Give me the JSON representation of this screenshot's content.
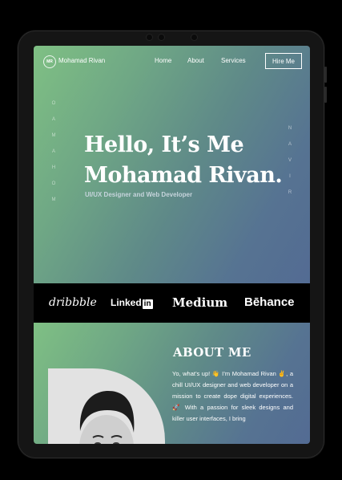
{
  "nav": {
    "logo_text": "MR",
    "brand": "Mohamad Rivan",
    "links": [
      "Home",
      "About",
      "Services"
    ],
    "cta": "Hire Me"
  },
  "hero": {
    "title_line1": "Hello, It’s Me",
    "title_line2": "Mohamad Rivan.",
    "subtitle": "UI/UX Designer and Web Developer",
    "vertical_left": [
      "O",
      "A",
      "M",
      "A",
      "H",
      "O",
      "M"
    ],
    "vertical_right": [
      "N",
      "A",
      "V",
      "I",
      "R"
    ]
  },
  "logos": {
    "dribbble": "dribbble",
    "linkedin_text": "Linked",
    "linkedin_box": "in",
    "medium": "Medium",
    "behance": "Bēhance"
  },
  "about": {
    "title": "ABOUT ME",
    "text": "Yo, what’s up! 👋 I’m Mohamad Rivan ✌️, a chill UI/UX designer and web developer on a mission to create dope digital experiences. 🚀 With a passion for sleek designs and killer user interfaces, I bring"
  },
  "colors": {
    "gradient_start": "#7fc084",
    "gradient_end": "#536b93",
    "logos_bar": "#000000"
  }
}
